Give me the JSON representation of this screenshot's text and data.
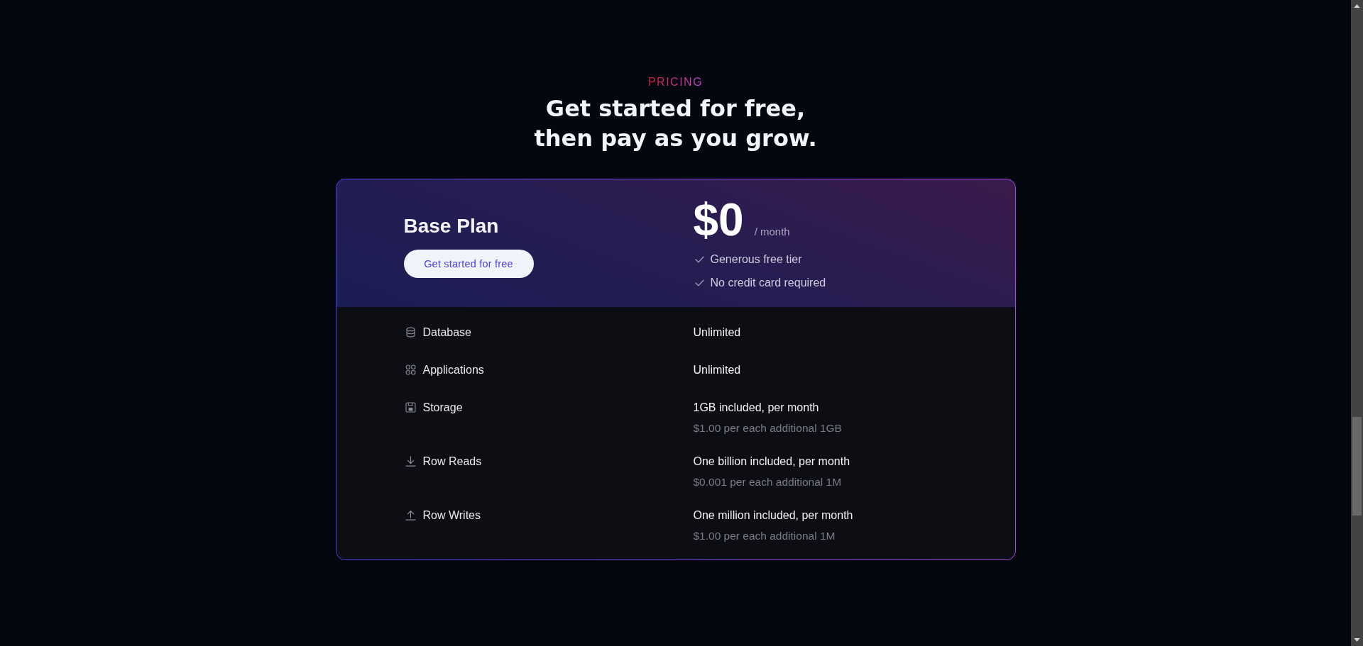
{
  "section": {
    "eyebrow": "PRICING",
    "heading_lines": [
      "Get started for free,",
      "then pay as you grow."
    ]
  },
  "plan": {
    "name": "Base Plan",
    "button": "Get started for free",
    "price": "$0",
    "period": "/ month",
    "highlights": [
      "Generous free tier",
      "No credit card required"
    ]
  },
  "features": [
    {
      "label": "Database",
      "value": "Unlimited"
    },
    {
      "label": "Applications",
      "value": "Unlimited"
    },
    {
      "label": "Storage",
      "value": "1GB included, per month",
      "note": "$1.00 per each additional 1GB"
    },
    {
      "label": "Row Reads",
      "value": "One billion included, per month",
      "note": "$0.001 per each additional 1M"
    },
    {
      "label": "Row Writes",
      "value": "One million included, per month",
      "note": "$1.00 per each additional 1M"
    }
  ]
}
